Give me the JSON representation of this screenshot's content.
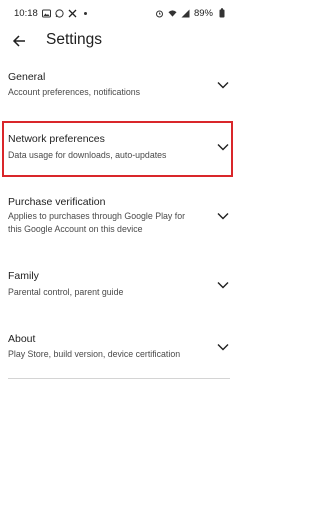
{
  "status_bar": {
    "time": "10:18",
    "battery": "89%",
    "left_icons": [
      "gallery-icon",
      "whatsapp-icon",
      "x-icon",
      "dot-icon"
    ],
    "right_icons": [
      "alarm-icon",
      "wifi-icon",
      "signal-icon",
      "battery-icon"
    ]
  },
  "header": {
    "title": "Settings",
    "back_icon": "arrow-back-icon"
  },
  "settings": [
    {
      "title": "General",
      "subtitle": "Account preferences, notifications"
    },
    {
      "title": "Network preferences",
      "subtitle": "Data usage for downloads, auto-updates"
    },
    {
      "title": "Purchase verification",
      "subtitle_line1": "Applies to purchases through Google Play for",
      "subtitle_line2": "this Google Account on this device"
    },
    {
      "title": "Family",
      "subtitle": "Parental control, parent guide"
    },
    {
      "title": "About",
      "subtitle": "Play Store, build version, device certification"
    }
  ],
  "colors": {
    "highlight": "#d9262a",
    "text": "#1f1f1f",
    "subtext": "#4a4a4a"
  }
}
